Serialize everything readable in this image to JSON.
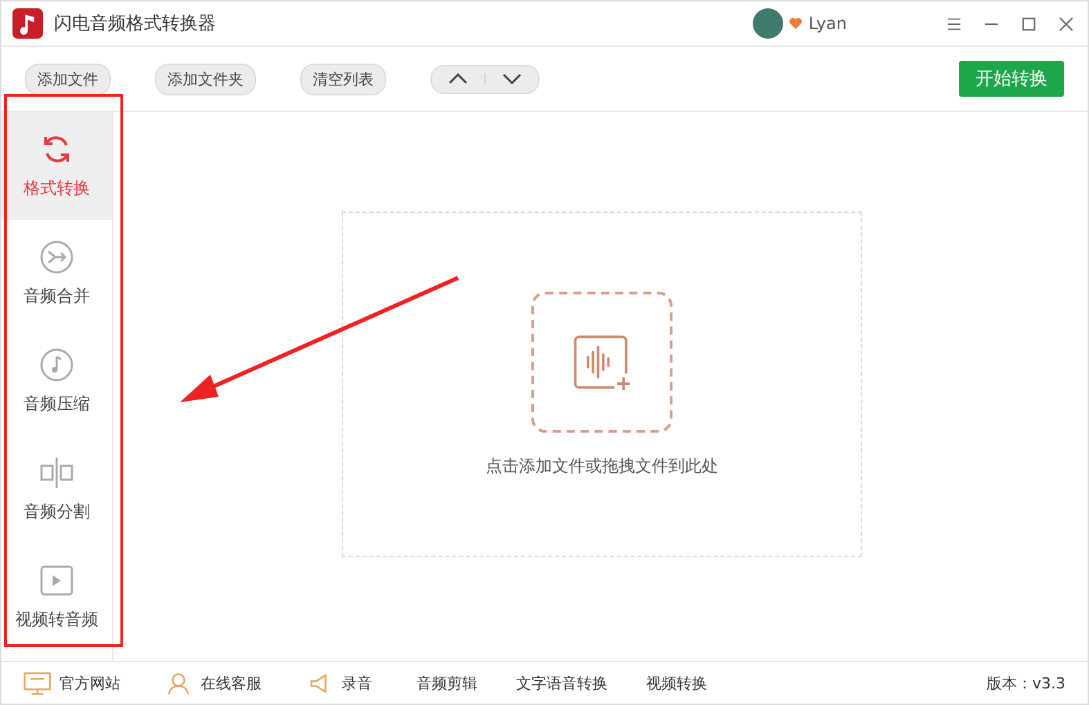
{
  "window": {
    "title": "闪电音频格式转换器",
    "user": "Lyan"
  },
  "toolbar": {
    "buttons": [
      "添加文件",
      "添加文件夹",
      "清空列表"
    ],
    "start_button": "开始转换"
  },
  "sidebar": {
    "items": [
      {
        "label": "格式转换",
        "selected": true
      },
      {
        "label": "音频合并",
        "selected": false
      },
      {
        "label": "音频压缩",
        "selected": false
      },
      {
        "label": "音频分割",
        "selected": false
      },
      {
        "label": "视频转音频",
        "selected": false
      }
    ]
  },
  "drop_zone": {
    "hint": "点击添加文件或拖拽文件到此处"
  },
  "status_bar": {
    "links": [
      "官方网站",
      "在线客服",
      "录音",
      "音频剪辑",
      "文字语音转换",
      "视频转换"
    ],
    "version": "版本：v3.3"
  }
}
